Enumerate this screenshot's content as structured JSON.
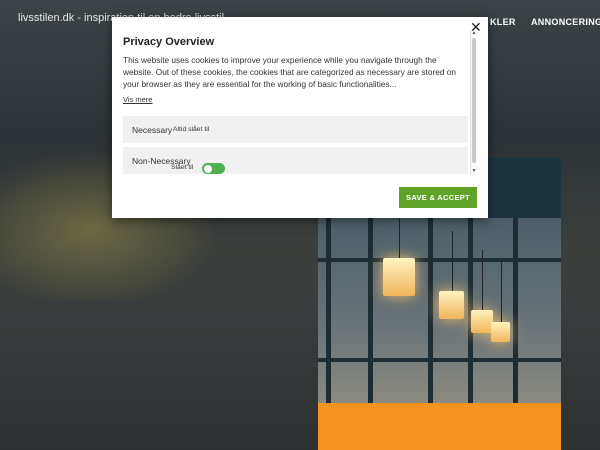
{
  "site": {
    "title": "livsstilen.dk - inspiration til en bedre livsstil",
    "nav": [
      "KLER",
      "ANNONCERING"
    ]
  },
  "modal": {
    "title": "Privacy Overview",
    "text": "This website uses cookies to improve your experience while you navigate through the website. Out of these cookies, the cookies that are categorized as necessary are stored on your browser as they are essential for the working of basic functionalities...",
    "read_more": "Vis mere",
    "close_icon": "close-icon",
    "categories": [
      {
        "label": "Necessary",
        "status": "Altid slået til"
      },
      {
        "label": "Non-Necessary",
        "toggle_label": "Slået til",
        "toggle_on": true
      }
    ],
    "save_button": "SAVE & ACCEPT"
  },
  "colors": {
    "accent_green": "#61a229",
    "toggle_green": "#4caf50",
    "orange": "#f39420"
  }
}
